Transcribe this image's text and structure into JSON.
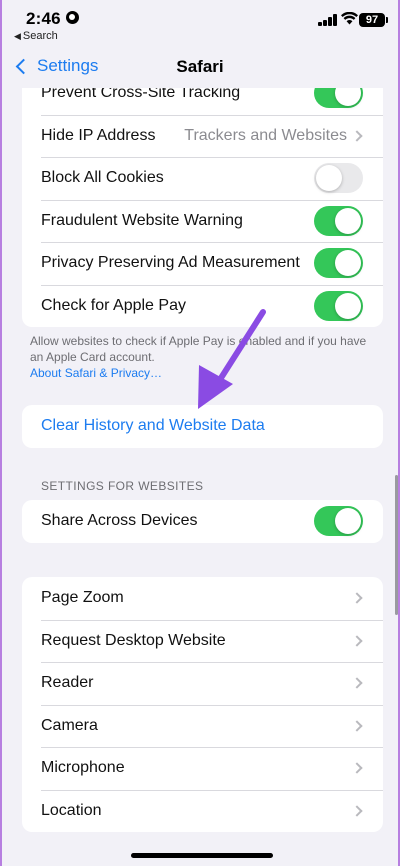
{
  "status": {
    "time": "2:46",
    "back_app": "Search",
    "battery": "97"
  },
  "nav": {
    "back_label": "Settings",
    "title": "Safari"
  },
  "privacy_group": {
    "items": [
      {
        "label": "Prevent Cross-Site Tracking",
        "control": "toggle",
        "on": true
      },
      {
        "label": "Hide IP Address",
        "control": "detail",
        "detail": "Trackers and Websites"
      },
      {
        "label": "Block All Cookies",
        "control": "toggle",
        "on": false
      },
      {
        "label": "Fraudulent Website Warning",
        "control": "toggle",
        "on": true
      },
      {
        "label": "Privacy Preserving Ad Measurement",
        "control": "toggle",
        "on": true
      },
      {
        "label": "Check for Apple Pay",
        "control": "toggle",
        "on": true
      }
    ]
  },
  "privacy_footer": {
    "text": "Allow websites to check if Apple Pay is enabled and if you have an Apple Card account.",
    "link": "About Safari & Privacy…"
  },
  "clear_history": {
    "label": "Clear History and Website Data"
  },
  "websites_section": {
    "header": "SETTINGS FOR WEBSITES",
    "share_label": "Share Across Devices",
    "share_on": true
  },
  "website_settings": {
    "items": [
      {
        "label": "Page Zoom"
      },
      {
        "label": "Request Desktop Website"
      },
      {
        "label": "Reader"
      },
      {
        "label": "Camera"
      },
      {
        "label": "Microphone"
      },
      {
        "label": "Location"
      }
    ]
  },
  "colors": {
    "accent": "#1c7cf0",
    "toggle_on": "#34c759",
    "annotation_arrow": "#8a4be3"
  }
}
